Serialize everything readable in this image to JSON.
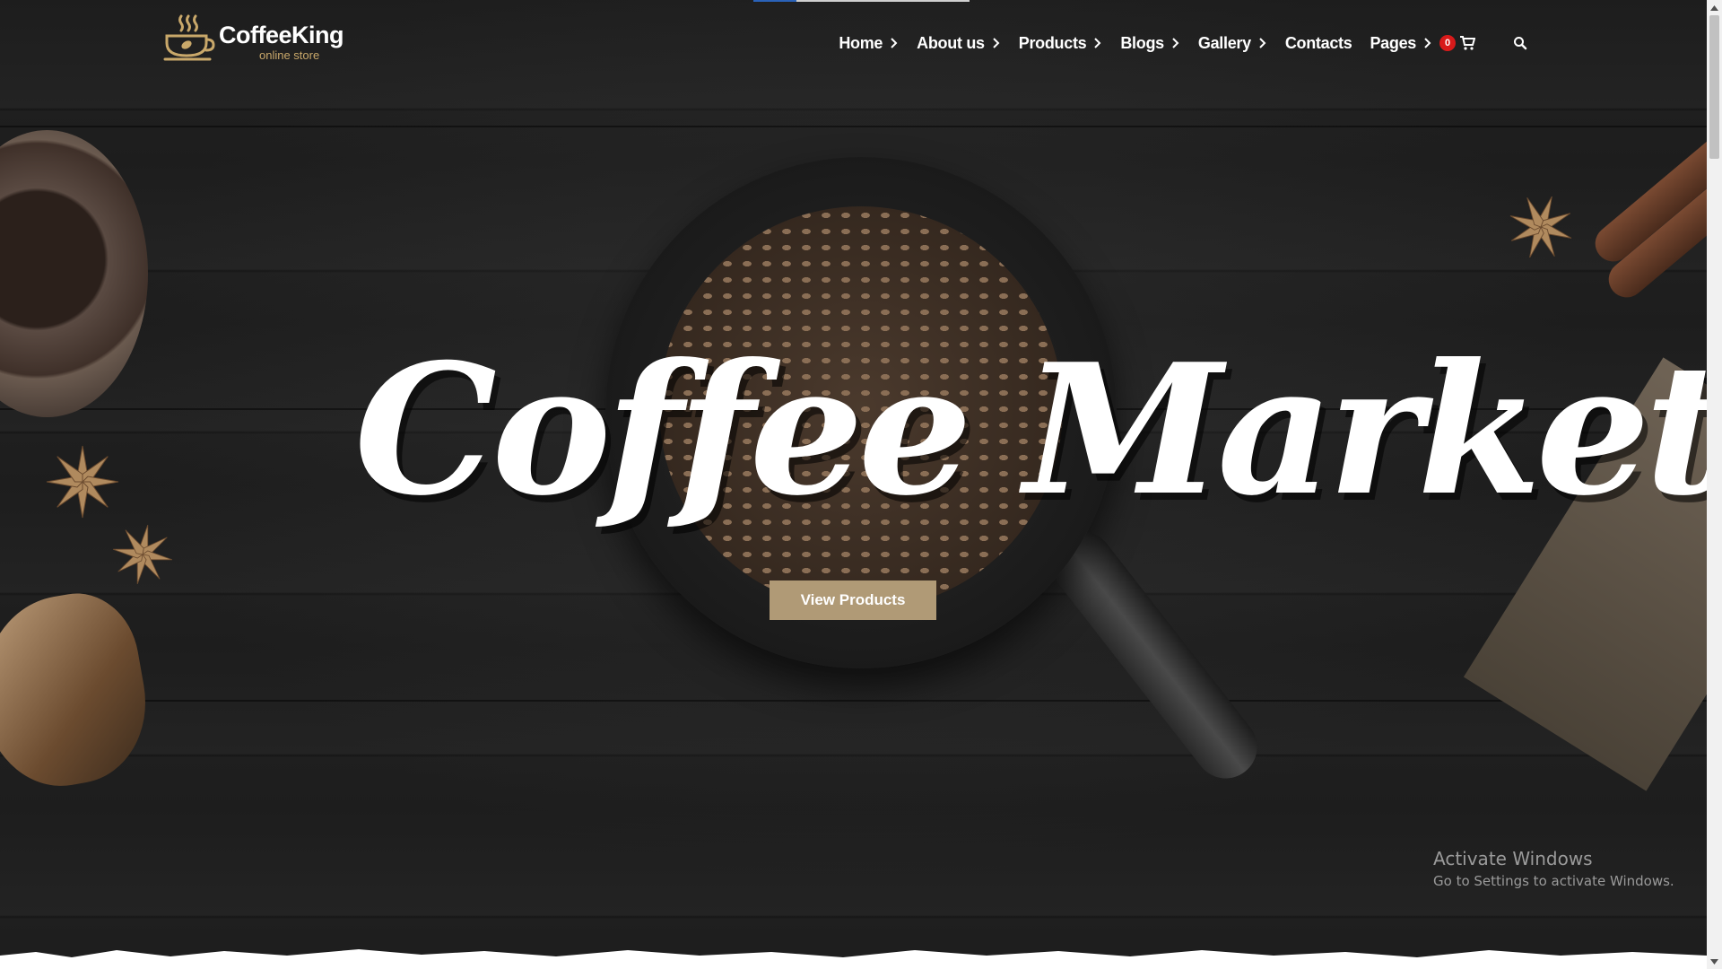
{
  "page": {
    "loading_progress": 0.2
  },
  "brand": {
    "name": "CoffeeKing",
    "tagline": "online store",
    "accent_color": "#c9a86a"
  },
  "nav": {
    "items": [
      {
        "label": "Home",
        "has_submenu": true
      },
      {
        "label": "About us",
        "has_submenu": true
      },
      {
        "label": "Products",
        "has_submenu": true
      },
      {
        "label": "Blogs",
        "has_submenu": true
      },
      {
        "label": "Gallery",
        "has_submenu": true
      },
      {
        "label": "Contacts",
        "has_submenu": false
      },
      {
        "label": "Pages",
        "has_submenu": true
      }
    ],
    "cart_count": "0",
    "cart_icon": "cart-icon",
    "search_icon": "search-icon"
  },
  "hero": {
    "title": "Coffee Market",
    "cta_label": "View Products",
    "cta_color": "#b09a76"
  },
  "os_watermark": {
    "title": "Activate Windows",
    "subtitle": "Go to Settings to activate Windows."
  }
}
